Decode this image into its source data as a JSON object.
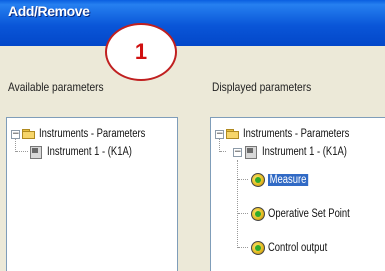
{
  "window": {
    "title": "Add/Remove"
  },
  "callout": {
    "number": "1"
  },
  "left_panel": {
    "label": "Available parameters",
    "root": "Instruments - Parameters",
    "items": [
      {
        "label": "Instrument 1 - (K1A)",
        "icon": "instrument-icon"
      }
    ]
  },
  "right_panel": {
    "label": "Displayed parameters",
    "root": "Instruments - Parameters",
    "instrument": "Instrument 1 - (K1A)",
    "params": [
      {
        "label": "Measure",
        "selected": true,
        "icon": "parameter-icon"
      },
      {
        "label": "Operative Set Point",
        "selected": false,
        "icon": "parameter-icon"
      },
      {
        "label": "Control output",
        "selected": false,
        "icon": "parameter-icon"
      }
    ]
  },
  "colors": {
    "titlebar": "#0a56d8",
    "selection": "#316ac5",
    "callout_border": "#c02020",
    "callout_text": "#d01010"
  }
}
